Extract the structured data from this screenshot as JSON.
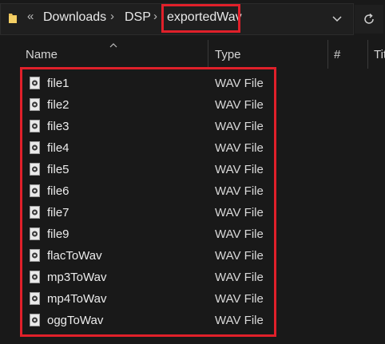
{
  "address": {
    "overflow_glyph": "«",
    "separator_glyph": "›",
    "crumbs": [
      "Downloads",
      "DSP",
      "exportedWav"
    ],
    "icons": {
      "folder": "folder-icon",
      "dropdown": "chevron-down-icon",
      "refresh": "refresh-icon"
    }
  },
  "columns": {
    "name": "Name",
    "type": "Type",
    "number": "#",
    "title": "Tit"
  },
  "files": [
    {
      "name": "file1",
      "type": "WAV File"
    },
    {
      "name": "file2",
      "type": "WAV File"
    },
    {
      "name": "file3",
      "type": "WAV File"
    },
    {
      "name": "file4",
      "type": "WAV File"
    },
    {
      "name": "file5",
      "type": "WAV File"
    },
    {
      "name": "file6",
      "type": "WAV File"
    },
    {
      "name": "file7",
      "type": "WAV File"
    },
    {
      "name": "file9",
      "type": "WAV File"
    },
    {
      "name": "flacToWav",
      "type": "WAV File"
    },
    {
      "name": "mp3ToWav",
      "type": "WAV File"
    },
    {
      "name": "mp4ToWav",
      "type": "WAV File"
    },
    {
      "name": "oggToWav",
      "type": "WAV File"
    }
  ],
  "colors": {
    "background": "#191919",
    "highlight": "#e0202a"
  }
}
